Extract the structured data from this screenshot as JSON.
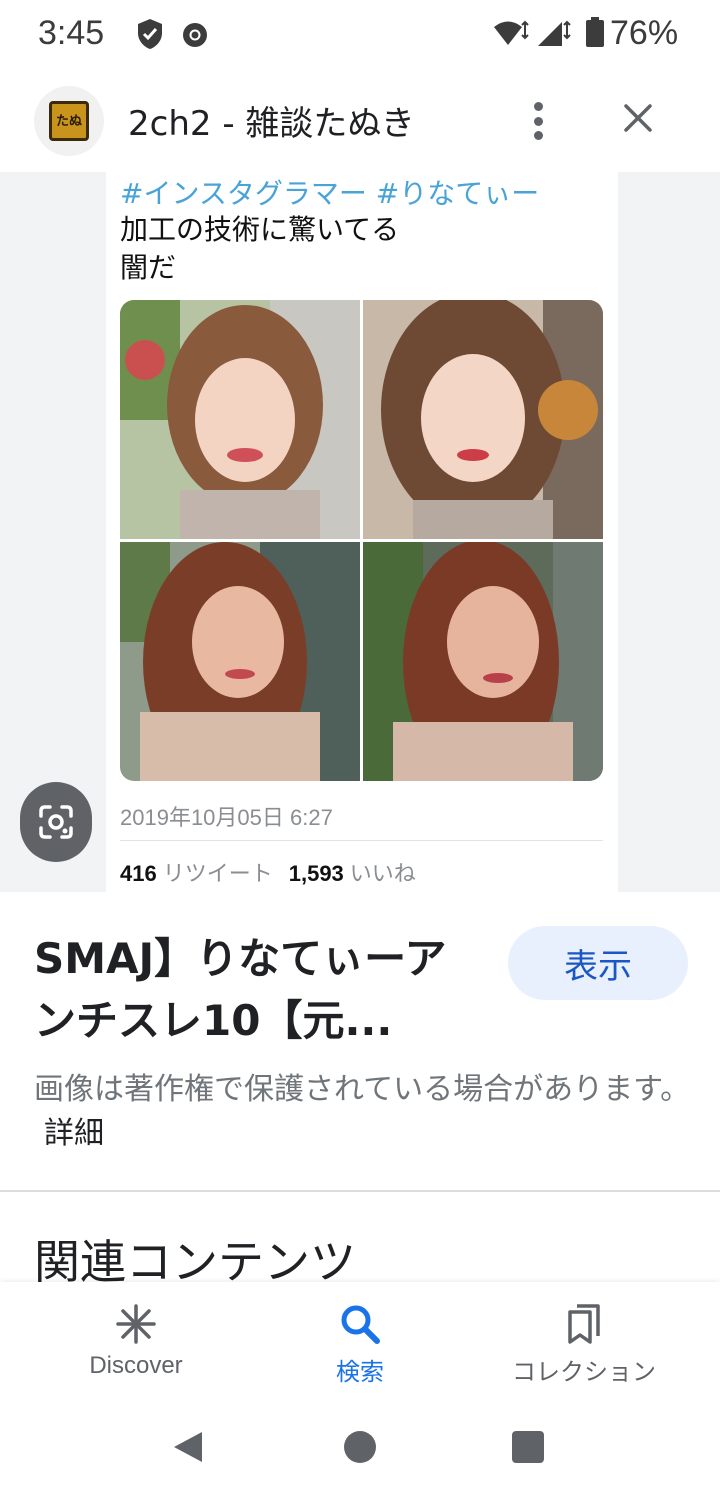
{
  "status_bar": {
    "time": "3:45",
    "battery_percent": "76%",
    "icons": [
      "shield-icon",
      "chrome-icon",
      "wifi-icon",
      "signal-icon",
      "battery-icon"
    ]
  },
  "header": {
    "site_name": "2ch2 - 雑談たぬき",
    "logo_text": "たぬ",
    "menu_icon": "more-vert-icon",
    "close_icon": "close-icon"
  },
  "image_preview": {
    "tweet": {
      "hashtags": "#インスタグラマー #りなてぃー",
      "line1": "加工の技術に驚いてる",
      "line2": "闇だ",
      "date": "2019年10月05日 6:27",
      "retweets_count": "416",
      "retweets_label": "リツイート",
      "likes_count": "1,593",
      "likes_label": "いいね"
    },
    "lens_icon": "lens-icon"
  },
  "result": {
    "title": "SMAJ】りなてぃーアンチスレ10【元...",
    "show_button": "表示",
    "copyright_notice": "画像は著作権で保護されている場合があります。",
    "details_link": "詳細"
  },
  "related": {
    "title": "関連コンテンツ"
  },
  "bottom_nav": {
    "items": [
      {
        "label": "Discover",
        "icon": "asterisk-icon",
        "active": false
      },
      {
        "label": "検索",
        "icon": "search-icon",
        "active": true
      },
      {
        "label": "コレクション",
        "icon": "bookmarks-icon",
        "active": false
      }
    ]
  },
  "colors": {
    "accent": "#1a73e8",
    "show_button_bg": "#e8f0fe",
    "hashtag": "#4aa3d8",
    "image_bg": "#f1f3f4"
  }
}
